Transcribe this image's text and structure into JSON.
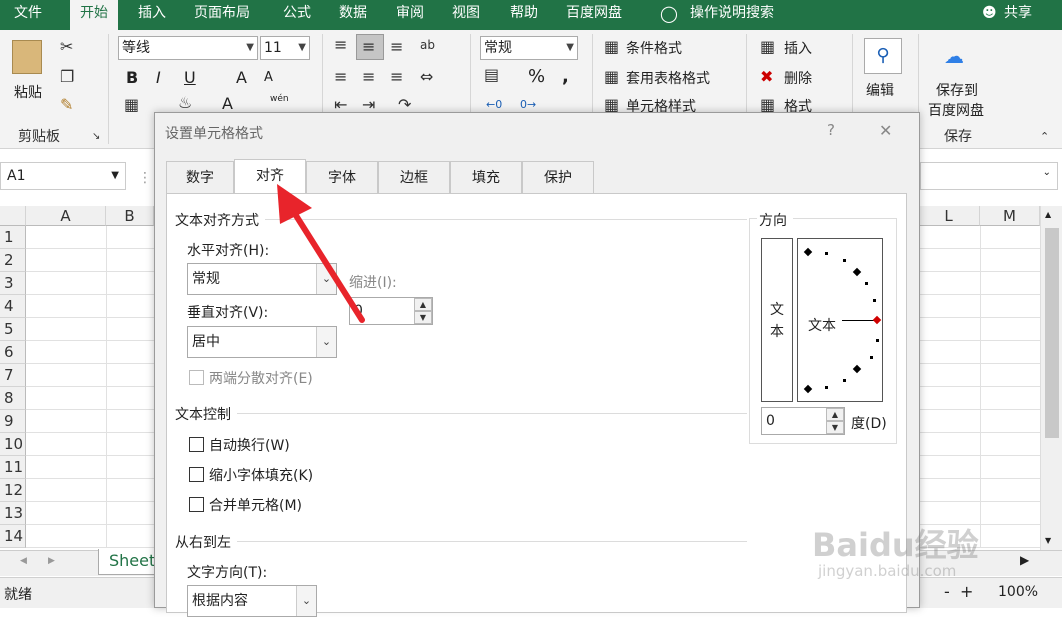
{
  "menu": [
    "文件",
    "开始",
    "插入",
    "页面布局",
    "公式",
    "数据",
    "审阅",
    "视图",
    "帮助",
    "百度网盘",
    "操作说明搜索",
    "共享"
  ],
  "ribbon": {
    "paste": "粘贴",
    "clipboard": "剪贴板",
    "font_name": "等线",
    "font_size": "11",
    "bold": "B",
    "italic": "I",
    "underline": "U",
    "grow": "A",
    "shrink": "A",
    "font_color": "A",
    "wen": "wén",
    "number_format": "常规",
    "percent": "%",
    "comma": ",",
    "cond": "条件格式",
    "table_fmt": "套用表格格式",
    "cell_style": "单元格样式",
    "insert": "插入",
    "delete": "删除",
    "format": "格式",
    "edit": "编辑",
    "save_baidu_1": "保存到",
    "save_baidu_2": "百度网盘",
    "save": "保存"
  },
  "formula": {
    "namebox": "A1"
  },
  "grid": {
    "cols": [
      "A",
      "B",
      "L",
      "M"
    ],
    "rows": [
      "1",
      "2",
      "3",
      "4",
      "5",
      "6",
      "7",
      "8",
      "9",
      "10",
      "11",
      "12",
      "13",
      "14"
    ]
  },
  "sheet": {
    "tab": "Sheet"
  },
  "status": {
    "ready": "就绪",
    "zoom": "100%",
    "minus": "-",
    "plus": "+"
  },
  "dialog": {
    "title": "设置单元格格式",
    "help": "?",
    "close": "✕",
    "tabs": [
      "数字",
      "对齐",
      "字体",
      "边框",
      "填充",
      "保护"
    ],
    "text_align": "文本对齐方式",
    "horizontal": "水平对齐(H):",
    "horizontal_val": "常规",
    "indent": "缩进(I):",
    "indent_val": "0",
    "vertical": "垂直对齐(V):",
    "vertical_val": "居中",
    "justify": "两端分散对齐(E)",
    "text_control": "文本控制",
    "wrap": "自动换行(W)",
    "shrink": "缩小字体填充(K)",
    "merge": "合并单元格(M)",
    "rtl": "从右到左",
    "text_dir": "文字方向(T):",
    "text_dir_val": "根据内容",
    "orientation": "方向",
    "vert_text_1": "文",
    "vert_text_2": "本",
    "orient_text": "文本",
    "degree_val": "0",
    "degree": "度(D)"
  },
  "watermark": {
    "text": "Baidu经验",
    "sub": "jingyan.baidu.com"
  },
  "colors": {
    "excel_green": "#217346",
    "arrow": "#e8242b"
  }
}
